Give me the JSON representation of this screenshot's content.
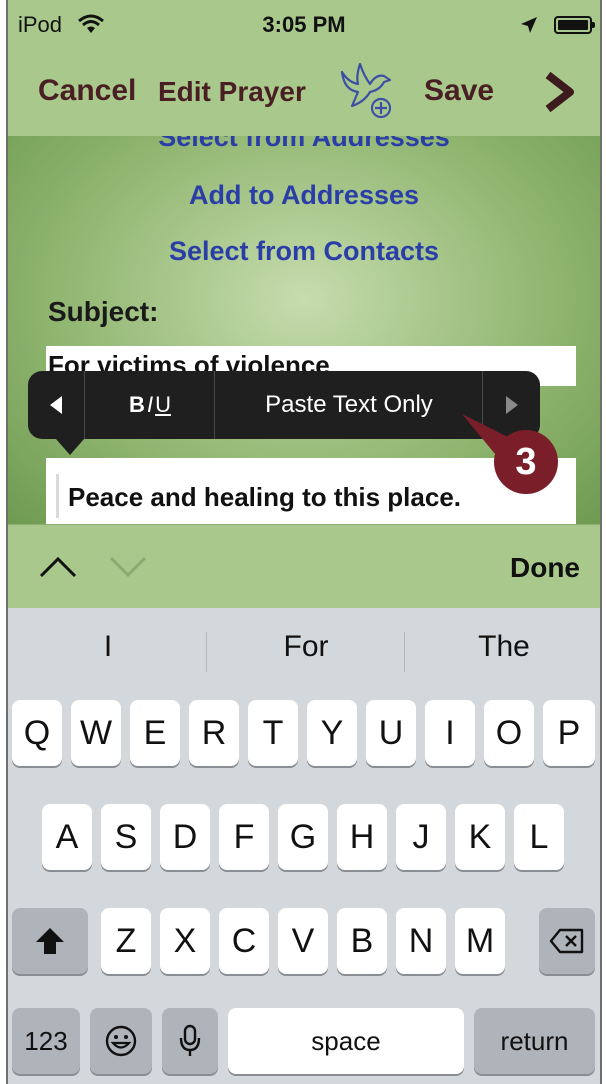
{
  "status_bar": {
    "carrier": "iPod",
    "time": "3:05 PM"
  },
  "nav": {
    "cancel_label": "Cancel",
    "title": "Edit Prayer",
    "save_label": "Save"
  },
  "content": {
    "cut_off_link": "Select from Addresses",
    "add_to_addresses": "Add to Addresses",
    "select_from_contacts": "Select from Contacts",
    "subject_label": "Subject:",
    "subject_value": "For victims of violence",
    "body_value": "Peace and healing to this place."
  },
  "edit_menu": {
    "bold": "B",
    "italic": "I",
    "underline": "U",
    "paste_text_only": "Paste Text Only"
  },
  "callout_number": "3",
  "keyboard_toolbar": {
    "done_label": "Done"
  },
  "keyboard": {
    "suggestions": [
      "I",
      "For",
      "The"
    ],
    "row1": [
      "Q",
      "W",
      "E",
      "R",
      "T",
      "Y",
      "U",
      "I",
      "O",
      "P"
    ],
    "row2": [
      "A",
      "S",
      "D",
      "F",
      "G",
      "H",
      "J",
      "K",
      "L"
    ],
    "row3": [
      "Z",
      "X",
      "C",
      "V",
      "B",
      "N",
      "M"
    ],
    "numbers_label": "123",
    "space_label": "space",
    "return_label": "return"
  },
  "colors": {
    "bar_green": "#a9c98c",
    "nav_text": "#4a1f23",
    "link_blue": "#2b3ea8",
    "callout": "#7a1f2a"
  }
}
